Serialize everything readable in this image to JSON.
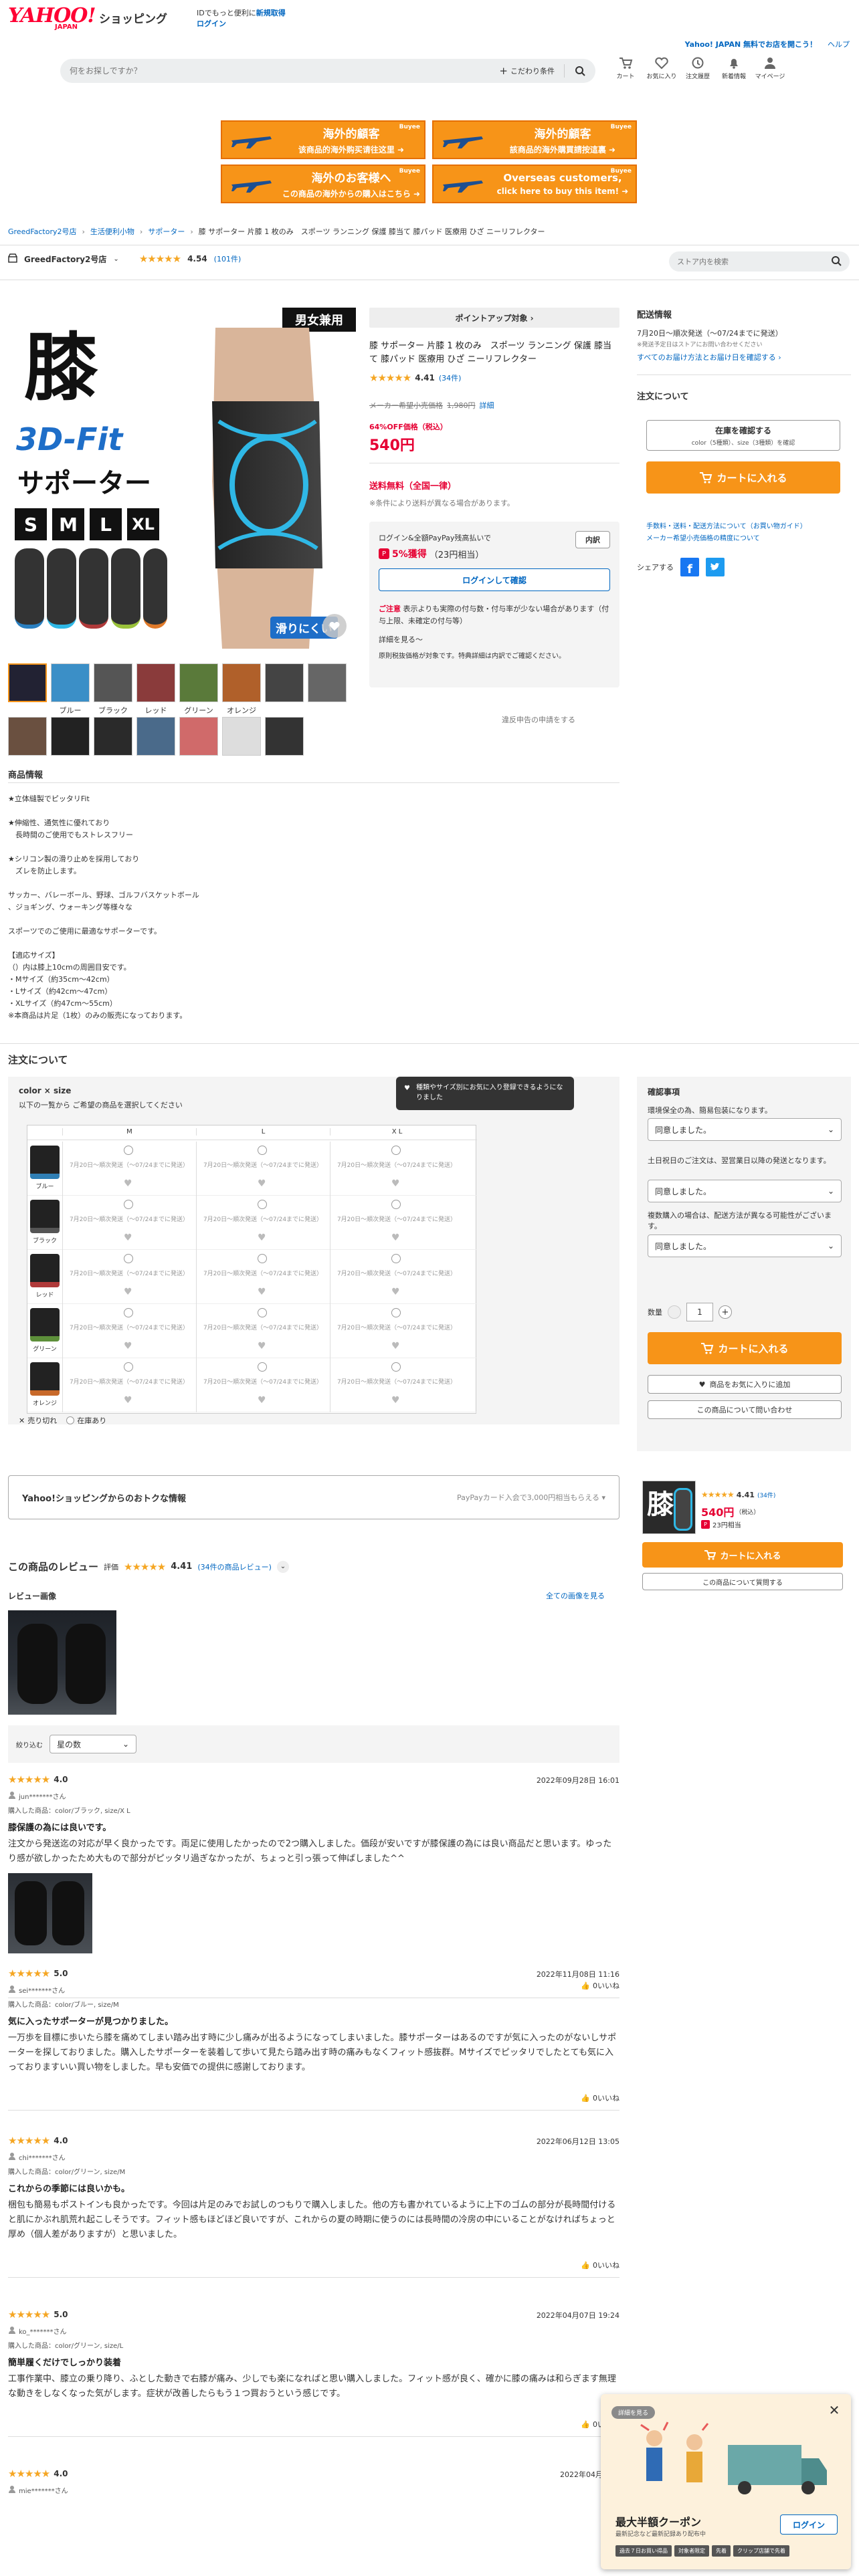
{
  "header": {
    "logo_main": "YAHOO!",
    "logo_sub": "JAPAN",
    "logo_service": "ショッピング",
    "login_prompt": "IDでもっと便利に",
    "register": "新規取得",
    "login": "ログイン",
    "promo": "Yahoo! JAPAN 無料でお店を開こう！",
    "help": "ヘルプ",
    "search_placeholder": "何をお探しですか？",
    "search_condition": "こだわり条件",
    "nav": [
      {
        "label": "カート",
        "icon": "cart-icon"
      },
      {
        "label": "お気に入り",
        "icon": "heart-icon"
      },
      {
        "label": "注文履歴",
        "icon": "history-icon"
      },
      {
        "label": "新着情報",
        "icon": "bell-icon"
      },
      {
        "label": "マイページ",
        "icon": "user-icon"
      }
    ]
  },
  "ads": [
    {
      "t1": "海外的顧客",
      "t2": "该商品的海外购买请往这里 ➜",
      "brand": "Buyee"
    },
    {
      "t1": "海外的顧客",
      "t2": "該商品的海外購買請按這裏 ➜",
      "brand": "Buyee"
    },
    {
      "t1": "海外のお客様へ",
      "t2": "この商品の海外からの購入はこちら ➜",
      "brand": "Buyee"
    },
    {
      "t1": "Overseas customers,",
      "t2": "click here to buy this item! ➜",
      "brand": "Buyee"
    }
  ],
  "breadcrumb": [
    "GreedFactory2号店",
    "生活便利小物",
    "サポーター",
    "膝 サポーター 片膝 1 枚のみ　スポーツ ランニング 保護 膝当て 膝パッド 医療用 ひざ ニーリフレクター"
  ],
  "store": {
    "name": "GreedFactory2号店",
    "rating": "4.54",
    "count": "(101件)",
    "search_placeholder": "ストア内を検索"
  },
  "gallery": {
    "main_big": "膝",
    "main_3d": "3D-Fit",
    "main_sup": "サポーター",
    "badge": "男女兼用",
    "sizes": [
      "S",
      "M",
      "L",
      "XL"
    ],
    "slide": "滑りにくい",
    "swatches": [
      {
        "label": "",
        "color": "#1a3a4a"
      },
      {
        "label": "ブルー",
        "color": "#3b8fc7"
      },
      {
        "label": "ブラック",
        "color": "#555"
      },
      {
        "label": "レッド",
        "color": "#b84040"
      },
      {
        "label": "グリーン",
        "color": "#6a9a3a"
      },
      {
        "label": "オレンジ",
        "color": "#d07030"
      },
      {
        "label": "",
        "color": "#444"
      },
      {
        "label": "",
        "color": "#666"
      }
    ]
  },
  "point_banner": "ポイントアップ対象 ›",
  "product": {
    "title": "膝 サポーター 片膝 1 枚のみ　スポーツ ランニング 保護 膝当て 膝パッド 医療用 ひざ ニーリフレクター",
    "rating": "4.41",
    "count": "(34件)",
    "regular_label": "メーカー希望小売価格",
    "regular_price": "1,980円",
    "detail": "詳細",
    "discount": "64%OFF価格（税込）",
    "price": "540円",
    "shipping": "送料無料（全国一律）",
    "shipping_note": "※条件により送料が異なる場合があります。",
    "paypay_intro": "ログイン&全額PayPay残高払いで",
    "paypay_badge": "内訳",
    "paypay_pct": "5%獲得",
    "paypay_yen": "（23円相当）",
    "login_btn": "ログインして確認",
    "note_title": "ご注意",
    "note_text": "表示よりも実際の付与数・付与率が少ない場合があります（付与上限、未確定の付与等）",
    "note_more": "詳細を見る～",
    "note_point": "原則税抜価格が対象です。特典詳細は内訳でご確認ください。",
    "report": "違反申告の申請をする"
  },
  "delivery": {
    "title": "配送情報",
    "date": "7月20日〜順次発送（〜07/24までに発送）",
    "note": "※発送予定日はストアにお問い合わせください",
    "all_dates": "すべてのお届け方法とお届け日を確認する ›",
    "order_title": "注文について",
    "stock_btn_title": "在庫を確認する",
    "stock_btn_sub": "color（5種類）、size（3種類）を確認",
    "cart": "カートに入れる",
    "fee_link": "手数料・送料・配送方法について（お買い物ガイド）",
    "maker_link": "メーカー希望小売価格の精度について",
    "share": "シェアする"
  },
  "info": {
    "title": "商品情報",
    "lines": [
      "★立体縫製でピッタリFit",
      "",
      "★伸縮性、通気性に優れており",
      "　長時間のご使用でもストレスフリー",
      "",
      "★シリコン製の滑り止めを採用しており",
      "　ズレを防止します。",
      "",
      "サッカー、バレーボール、野球、ゴルフバスケットボール",
      "、ジョギング、ウォーキング等様々な",
      "",
      "スポーツでのご使用に最適なサポーターです。",
      "",
      "【適応サイズ】",
      "（）内は膝上10cmの周囲目安です。",
      "・Mサイズ（約35cm〜42cm）",
      "・Lサイズ（約42cm〜47cm）",
      "・XLサイズ（約47cm〜55cm）",
      "※本商品は片足（1枚）のみの販売になっております。"
    ]
  },
  "order": {
    "title": "注文について",
    "color_size": "color × size",
    "instruction": "以下の一覧から ご希望の商品を選択してください",
    "tooltip": "種類やサイズ別にお気に入り登録できるようになりました",
    "sizes": [
      "M",
      "L",
      "X L"
    ],
    "cell": "7月20日〜順次発送（〜07/24までに発送）",
    "colors": [
      {
        "name": "ブルー",
        "color": "#2f7fb5"
      },
      {
        "name": "ブラック",
        "color": "#555"
      },
      {
        "name": "レッド",
        "color": "#b03a3a"
      },
      {
        "name": "グリーン",
        "color": "#5d8f3a"
      },
      {
        "name": "オレンジ",
        "color": "#c8692a"
      }
    ],
    "legend_sold": "売り切れ",
    "legend_stock": "在庫あり",
    "confirm_title": "確認事項",
    "q1": "環境保全の為、簡易包装になります。",
    "q2": "土日祝日のご注文は、翌営業日以降の発送となります。",
    "q3": "複数購入の場合は、配送方法が異なる可能性がございます。",
    "answer": "同意しました。",
    "qty_label": "数量",
    "qty": "1",
    "cart": "カートに入れる",
    "fav": "商品をお気に入りに追加",
    "inquiry": "この商品について問い合わせ"
  },
  "deals": {
    "title": "Yahoo!ショッピングからのおトクな情報",
    "paypay": "PayPayカード入会で3,000円相当もらえる ▾"
  },
  "sticky": {
    "rating": "4.41",
    "count": "(34件)",
    "price": "540円",
    "tax": "（税込）",
    "points": "23円相当",
    "cart": "カートに入れる",
    "inquiry": "この商品について質問する"
  },
  "reviews": {
    "title": "この商品のレビュー",
    "eval": "評価",
    "rating": "4.41",
    "count": "(34件の商品レビュー)",
    "images_title": "レビュー画像",
    "see_all": "全ての画像を見る",
    "filter_label": "絞り込む",
    "filter": "星の数",
    "items": [
      {
        "stars": "4.0",
        "date": "2022年09月28日 16:01",
        "user": "jun*******さん",
        "bought": "購入した商品：color/ブラック, size/X L",
        "title": "膝保護の為には良いです。",
        "body": "注文から発送迄の対応が早く良かったです。両足に使用したかったので2つ購入しました。価段が安いですが膝保護の為には良い商品だと思います。ゆったり感が欲しかったため大もので部分がピッタリ過ぎなかったが、ちょっと引っ張って伸ばしました^^",
        "useful": "0いいね",
        "has_image": true
      },
      {
        "stars": "5.0",
        "date": "2022年11月08日 11:16",
        "user": "sei*******さん",
        "bought": "購入した商品：color/ブルー, size/M",
        "title": "気に入ったサポーターが見つかりました。",
        "body": "一万歩を目標に歩いたら膝を痛めてしまい踏み出す時に少し痛みが出るようになってしまいました。膝サポーターはあるのですが気に入ったのがないしサポーターを探しておりました。購入したサポーターを装着して歩いて見たら踏み出す時の痛みもなくフィット感抜群。Mサイズでピッタリでしたとても気に入っておりますいい買い物をしました。早も安価での提供に感謝しております。",
        "useful": "0いいね",
        "has_image": false
      },
      {
        "stars": "4.0",
        "date": "2022年06月12日 13:05",
        "user": "chi*******さん",
        "bought": "購入した商品：color/グリーン, size/M",
        "title": "これからの季節には良いかも。",
        "body": "梱包も簡易もポストインも良かったです。今回は片足のみでお試しのつもりで購入しました。他の方も書かれているように上下のゴムの部分が長時間付けると肌にかぶれ肌荒れ起こしそうです。フィット感もほどほど良いですが、これからの夏の時期に使うのには長時間の冷房の中にいることがなければちょっと厚め（個人差がありますが）と思いました。",
        "useful": "0いいね",
        "has_image": false
      },
      {
        "stars": "5.0",
        "date": "2022年04月07日 19:24",
        "user": "ko_*******さん",
        "bought": "購入した商品：color/グリーン, size/L",
        "title": "簡単履くだけでしっかり装着",
        "body": "工事作業中、膝立の乗り降り、ふとした動きで右膝が痛み、少しでも楽になればと思い購入しました。フィット感が良く、確かに膝の痛みは和らぎます無理な動きをしなくなった気がします。症状が改善したらもう１つ買おうという感じです。",
        "useful": "0いいね",
        "has_image": false
      },
      {
        "stars": "4.0",
        "date": "2022年04月19日",
        "user": "mie*******さん",
        "bought": "",
        "title": "",
        "body": "",
        "useful": "",
        "has_image": false
      }
    ]
  },
  "popup": {
    "tag": "詳細を見る",
    "title": "最大半額クーポン",
    "sub": "最新記念など最新記録あり配布中",
    "login": "ログイン",
    "chips": [
      "過去７日お買い得品",
      "対象者限定",
      "先着",
      "クリップ店舗で先着"
    ]
  }
}
